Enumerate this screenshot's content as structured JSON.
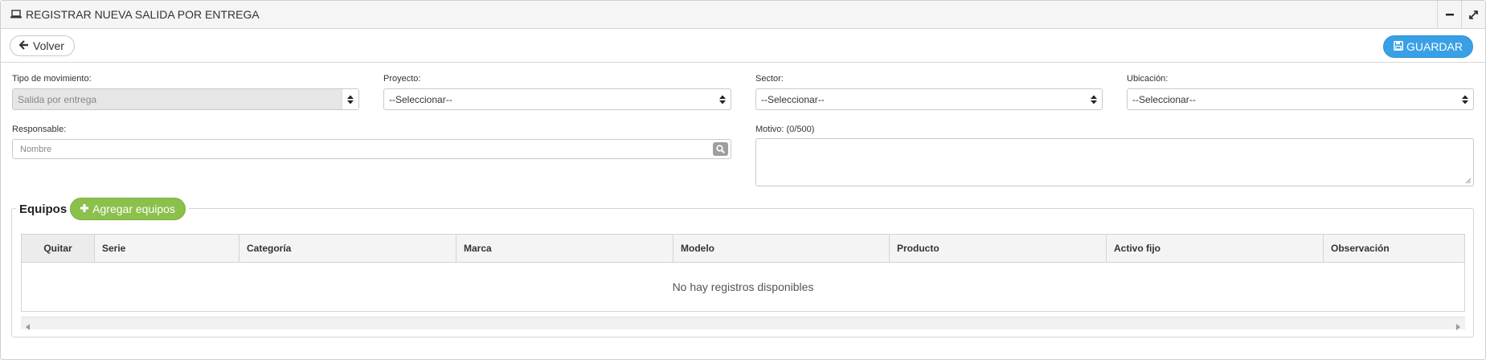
{
  "header": {
    "title": "REGISTRAR NUEVA SALIDA POR ENTREGA",
    "icon": "laptop-icon",
    "tools": [
      "minimize-icon",
      "expand-icon"
    ]
  },
  "actions": {
    "back_label": "Volver",
    "save_label": "GUARDAR"
  },
  "form": {
    "tipo": {
      "label": "Tipo de movimiento:",
      "value": "Salida por entrega"
    },
    "proyecto": {
      "label": "Proyecto:",
      "value": "--Seleccionar--"
    },
    "sector": {
      "label": "Sector:",
      "value": "--Seleccionar--"
    },
    "ubicacion": {
      "label": "Ubicación:",
      "value": "--Seleccionar--"
    },
    "responsable": {
      "label": "Responsable:",
      "placeholder": "Nombre"
    },
    "motivo": {
      "label": "Motivo: (0/500)"
    }
  },
  "equipos": {
    "legend": "Equipos",
    "add_label": "Agregar equipos",
    "columns": [
      "Quitar",
      "Serie",
      "Categoría",
      "Marca",
      "Modelo",
      "Producto",
      "Activo fijo",
      "Observación"
    ],
    "empty_text": "No hay registros disponibles"
  },
  "colors": {
    "save_button": "#3aa0e6",
    "add_button": "#8cc04c",
    "header_bg": "#f5f5f5"
  }
}
